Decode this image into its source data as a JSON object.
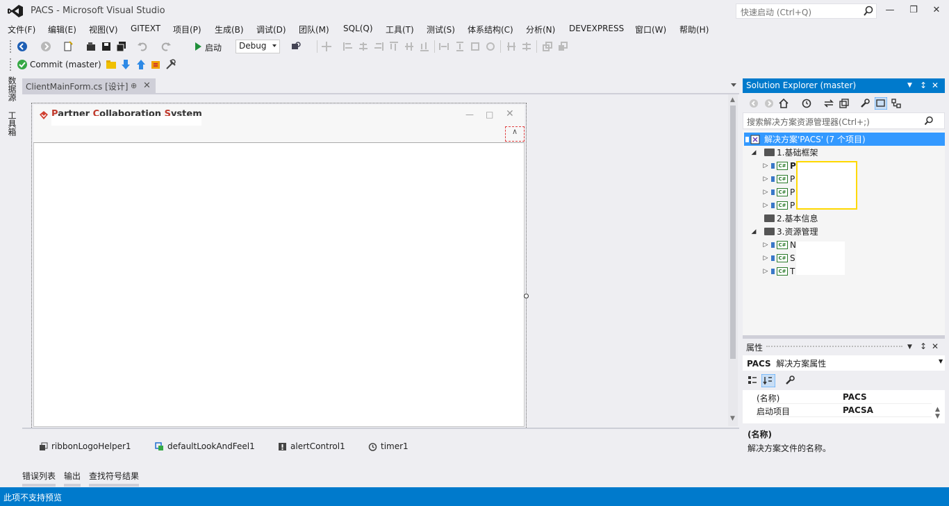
{
  "window": {
    "title": "PACS - Microsoft Visual Studio",
    "quick_launch_placeholder": "快速启动 (Ctrl+Q)"
  },
  "menu": [
    "文件(F)",
    "编辑(E)",
    "视图(V)",
    "GITEXT",
    "项目(P)",
    "生成(B)",
    "调试(D)",
    "团队(M)",
    "SQL(Q)",
    "工具(T)",
    "测试(S)",
    "体系结构(C)",
    "分析(N)",
    "DEVEXPRESS",
    "窗口(W)",
    "帮助(H)"
  ],
  "toolbar": {
    "start_label": "启动",
    "config": "Debug",
    "commit_label": "Commit (master)"
  },
  "left_tabs": [
    "数据源",
    "工具箱"
  ],
  "document": {
    "tab_label": "ClientMainForm.cs [设计]"
  },
  "form": {
    "title_p": "P",
    "title_artner": "artner ",
    "title_c": "C",
    "title_ollaboration": "ollaboration ",
    "title_s": "S",
    "title_ystem": "ystem"
  },
  "tray": [
    "ribbonLogoHelper1",
    "defaultLookAndFeel1",
    "alertControl1",
    "timer1"
  ],
  "bottom_tabs": [
    "错误列表",
    "输出",
    "查找符号结果"
  ],
  "status": "此项不支持预览",
  "solution_explorer": {
    "title": "Solution Explorer (master)",
    "search_placeholder": "搜索解决方案资源管理器(Ctrl+;)",
    "solution": "解决方案'PACS' (7 个项目)",
    "folder1": "1.基础框架",
    "folder2": "2.基本信息",
    "folder3": "3.资源管理",
    "projects_f1": [
      "P",
      "P",
      "P",
      "P"
    ],
    "projects_f3": [
      "N",
      "S",
      "T"
    ]
  },
  "properties": {
    "title": "属性",
    "object_name": "PACS",
    "object_type": "解决方案属性",
    "rows": [
      {
        "name": "(名称)",
        "value": "PACS"
      },
      {
        "name": "启动项目",
        "value": "PACSA"
      }
    ],
    "desc_title": "(名称)",
    "desc_text": "解决方案文件的名称。"
  },
  "colors": {
    "accent": "#007acc",
    "selection": "#3399ff",
    "mask_border": "#ffd800"
  }
}
